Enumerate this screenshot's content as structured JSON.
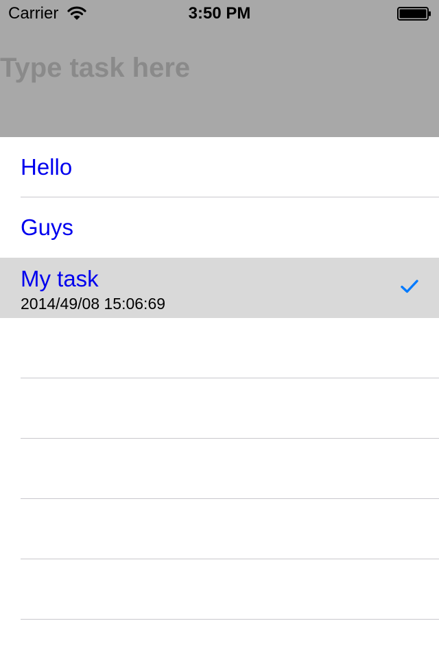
{
  "status_bar": {
    "carrier": "Carrier",
    "time": "3:50 PM",
    "wifi_icon": "wifi-icon",
    "battery_icon": "battery-icon"
  },
  "task_input": {
    "placeholder": "Type task here",
    "value": ""
  },
  "tasks": [
    {
      "title": "Hello",
      "subtitle": "",
      "checked": false,
      "selected": false
    },
    {
      "title": "Guys",
      "subtitle": "",
      "checked": false,
      "selected": false
    },
    {
      "title": "My task",
      "subtitle": "2014/49/08 15:06:69",
      "checked": true,
      "selected": true
    }
  ],
  "colors": {
    "header_bg": "#a8a8a8",
    "title_text": "#0000ee",
    "selected_row_bg": "#d9d9d9",
    "checkmark": "#007aff",
    "separator": "#c8c7cc"
  }
}
